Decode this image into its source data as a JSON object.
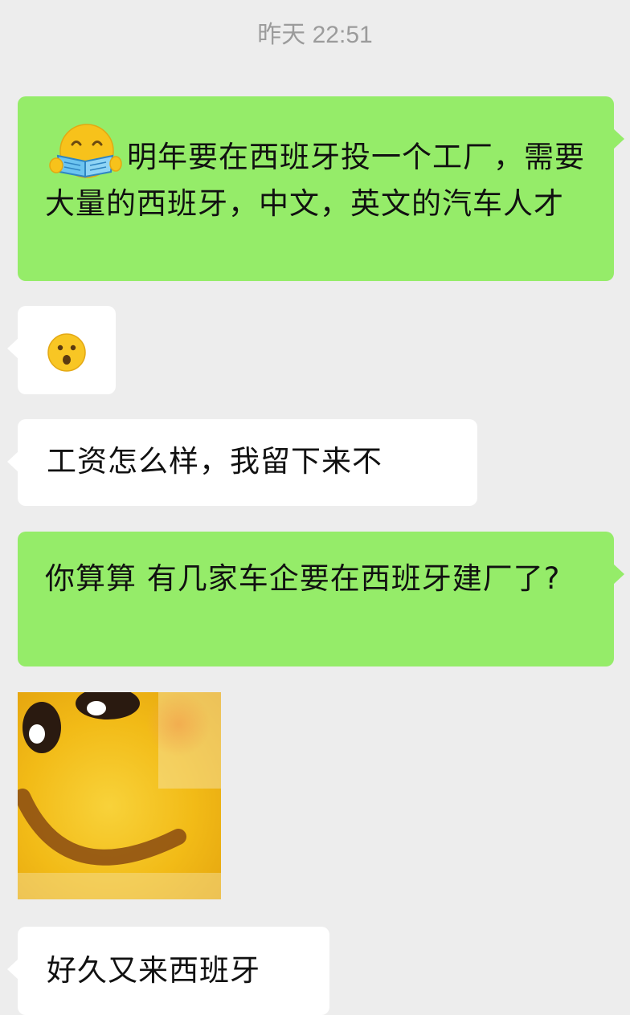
{
  "timestamp": "昨天 22:51",
  "messages": [
    {
      "side": "sent",
      "emoji": "smiling-reading-book",
      "text": "明年要在西班牙投一个工厂，需要大量的西班牙，中文，英文的汽车人才"
    },
    {
      "side": "received",
      "emoji": "hushed-face"
    },
    {
      "side": "received",
      "text": "工资怎么样，我留下来不"
    },
    {
      "side": "sent",
      "text": "你算算 有几家车企要在西班牙建厂了?"
    },
    {
      "side": "received",
      "sticker": "smiling-face-closeup"
    },
    {
      "side": "received",
      "text": "好久又来西班牙"
    }
  ],
  "colors": {
    "background": "#ededed",
    "sent_bubble": "#95ec69",
    "received_bubble": "#ffffff",
    "timestamp_text": "#9b9b9b"
  }
}
